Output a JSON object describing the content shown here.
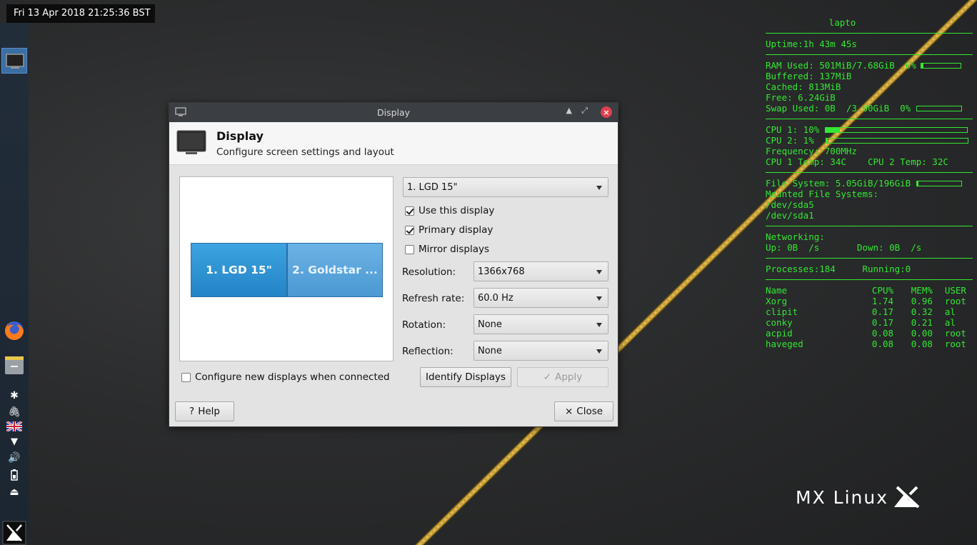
{
  "clock": "Fri 13 Apr 2018 21:25:36 BST",
  "dialog": {
    "window_title": "Display",
    "header_title": "Display",
    "header_subtitle": "Configure screen settings and layout",
    "monitors": [
      "1. LGD 15\"",
      "2. Goldstar ..."
    ],
    "output_select": "1. LGD 15\"",
    "use_this_display": "Use this display",
    "use_this_display_checked": true,
    "primary_display": "Primary display",
    "primary_display_checked": true,
    "mirror_displays": "Mirror displays",
    "mirror_displays_checked": false,
    "resolution_label": "Resolution:",
    "resolution_value": "1366x768",
    "refresh_label": "Refresh rate:",
    "refresh_value": "60.0 Hz",
    "rotation_label": "Rotation:",
    "rotation_value": "None",
    "reflection_label": "Reflection:",
    "reflection_value": "None",
    "configure_new": "Configure new displays when connected",
    "configure_new_checked": false,
    "identify_button": "Identify Displays",
    "apply_button": "Apply",
    "help_button": "Help",
    "close_button": "Close"
  },
  "conky": {
    "hostname": "lapto",
    "uptime": "Uptime:1h 43m 45s",
    "ram_used": "RAM Used: 501MiB/7.68GiB  6%",
    "ram_pct": 6,
    "buffered": "Buffered: 137MiB",
    "cached": "Cached: 813MiB",
    "free": "Free: 6.24GiB",
    "swap_used": "Swap Used: 0B  /3.00GiB  0%",
    "swap_pct": 0,
    "cpu1": "CPU 1: 10%",
    "cpu1_pct": 10,
    "cpu2": "CPU 2: 1%",
    "cpu2_pct": 1,
    "frequency": "Frequency: 700MHz",
    "temps": "CPU 1 Temp: 34C    CPU 2 Temp: 32C",
    "fs": "File System: 5.05GiB/196GiB",
    "fs_pct": 3,
    "mounted": "Mounted File Systems:",
    "mount1": "/dev/sda5",
    "mount2": "/dev/sda1",
    "networking": "Networking:",
    "net": "Up: 0B  /s       Down: 0B  /s",
    "processes": "Processes:184     Running:0",
    "proc_header": [
      "Name",
      "CPU%",
      "MEM%",
      "USER"
    ],
    "procs": [
      [
        "Xorg",
        "1.74",
        "0.96",
        "root"
      ],
      [
        "clipit",
        "0.17",
        "0.32",
        "al"
      ],
      [
        "conky",
        "0.17",
        "0.21",
        "al"
      ],
      [
        "acpid",
        "0.08",
        "0.00",
        "root"
      ],
      [
        "haveged",
        "0.08",
        "0.08",
        "root"
      ]
    ]
  },
  "brand": "MX Linux",
  "colors": {
    "conky_green": "#32e832",
    "panel": "#1f2a36",
    "monitor_blue": "#2484c6"
  },
  "icons": [
    "display-icon",
    "firefox-icon",
    "file-manager-icon",
    "bluetooth-icon",
    "clipboard-icon",
    "uk-flag-icon",
    "wifi-icon",
    "volume-icon",
    "battery-icon",
    "eject-icon",
    "mx-menu-icon"
  ]
}
